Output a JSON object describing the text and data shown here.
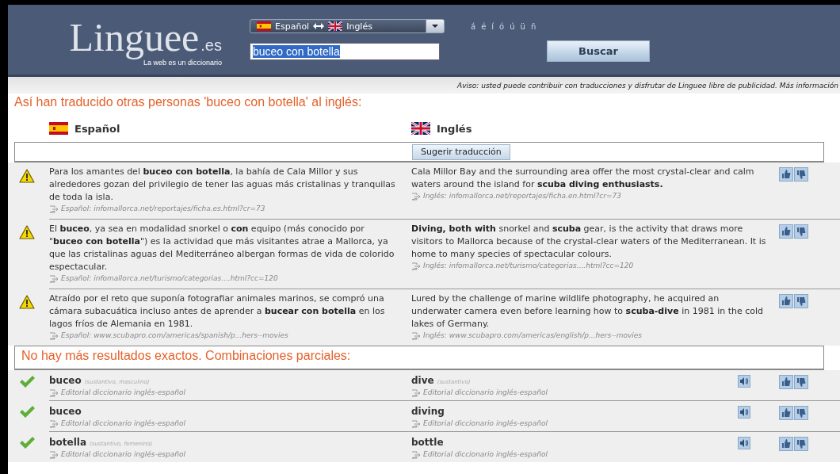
{
  "header": {
    "logo": {
      "name": "Linguee",
      "domain": ".es",
      "tagline": "La web es un diccionario"
    },
    "language_selector": {
      "source": {
        "label": "Español",
        "kind": "es"
      },
      "target": {
        "label": "Inglés",
        "kind": "uk"
      }
    },
    "accents": [
      "á",
      "é",
      "í",
      "ó",
      "ú",
      "ü",
      "ñ"
    ],
    "search": {
      "value": "buceo con botella",
      "text_selected": true
    },
    "search_button": "Buscar"
  },
  "notice": "Aviso: usted puede contribuir con traducciones y disfrutar de Linguee libre de publicidad. Más información",
  "heading": "Así han traducido otras personas 'buceo con botella' al inglés:",
  "columns": [
    {
      "label": "Español",
      "kind": "es"
    },
    {
      "label": "Inglés",
      "kind": "uk"
    }
  ],
  "suggest_button": "Sugerir traducción",
  "examples": [
    {
      "source": "Para los amantes del **buceo con botella**, la bahía de Cala Millor y sus alrededores gozan del privilegio de tener las aguas más cristalinas y tranquilas de toda la isla.",
      "source_ref": "Español: infomallorca.net/reportajes/ficha.es.html?cr=73",
      "target": "Cala Millor Bay and the surrounding area offer the most crystal-clear and calm waters around the island for **scuba diving enthusiasts.**",
      "target_ref": "Inglés: infomallorca.net/reportajes/ficha.en.html?cr=73"
    },
    {
      "source": "El **buceo**, ya sea en modalidad snorkel o **con** equipo (más conocido por \"**buceo con botella**\") es la actividad que más visitantes atrae a Mallorca, ya que las cristalinas aguas del Mediterráneo albergan formas de vida de colorido espectacular.",
      "source_ref": "Español: infomallorca.net/turismo/categorias....html?cc=120",
      "target": "**Diving, both with** snorkel and **scuba** gear, is the activity that draws more visitors to Mallorca because of the crystal-clear waters of the Mediterranean. It is home to many species of spectacular colours.",
      "target_ref": "Inglés: infomallorca.net/turismo/categorias....html?cc=120"
    },
    {
      "source": "Atraído por el reto que suponía fotografiar animales marinos, se compró una cámara subacuática incluso antes de aprender a **bucear con botella** en los lagos fríos de Alemania en 1981.",
      "source_ref": "Español: www.scubapro.com/americas/spanish/p...hers--movies",
      "target": "Lured by the challenge of marine wildlife photography, he acquired an underwater camera even before learning how to **scuba-dive** in 1981 in the cold lakes of Germany.",
      "target_ref": "Inglés: www.scubapro.com/americas/english/p...hers--movies"
    }
  ],
  "partial_heading": "No hay más resultados exactos. Combinaciones parciales:",
  "entries": [
    {
      "source_word": "buceo",
      "source_grammar": "(sustantivo, masculino)",
      "source_ref": "Editorial diccionario inglés-español",
      "target_word": "dive",
      "target_grammar": "(sustantivo)",
      "target_ref": "Editorial diccionario inglés-español"
    },
    {
      "source_word": "buceo",
      "source_ref": "Editorial diccionario inglés-español",
      "target_word": "diving",
      "target_ref": "Editorial diccionario inglés-español"
    },
    {
      "source_word": "botella",
      "source_grammar": "(sustantivo, femenino)",
      "source_ref": "Editorial diccionario inglés-español",
      "target_word": "bottle",
      "target_ref": "Editorial diccionario inglés-español"
    }
  ]
}
